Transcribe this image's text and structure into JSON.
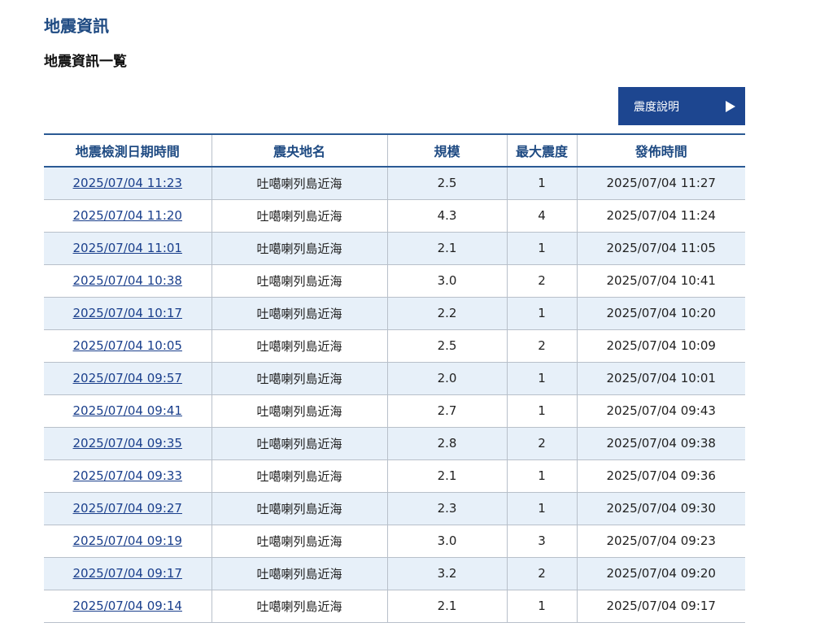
{
  "page": {
    "title": "地震資訊",
    "subtitle": "地震資訊一覧"
  },
  "intensity_button": {
    "label": "震度說明",
    "icon": "play-arrow-icon"
  },
  "colors": {
    "title": "#1e4a82",
    "button_bg": "#1d4690",
    "row_stripe": "#e7f0f9",
    "link": "#1a3f8c"
  },
  "table": {
    "columns": [
      "地震檢測日期時間",
      "震央地名",
      "規模",
      "最大震度",
      "發佈時間"
    ],
    "rows": [
      {
        "detected": "2025/07/04 11:23",
        "epicenter": "吐噶喇列島近海",
        "magnitude": "2.5",
        "max_intensity": "1",
        "published": "2025/07/04 11:27"
      },
      {
        "detected": "2025/07/04 11:20",
        "epicenter": "吐噶喇列島近海",
        "magnitude": "4.3",
        "max_intensity": "4",
        "published": "2025/07/04 11:24"
      },
      {
        "detected": "2025/07/04 11:01",
        "epicenter": "吐噶喇列島近海",
        "magnitude": "2.1",
        "max_intensity": "1",
        "published": "2025/07/04 11:05"
      },
      {
        "detected": "2025/07/04 10:38",
        "epicenter": "吐噶喇列島近海",
        "magnitude": "3.0",
        "max_intensity": "2",
        "published": "2025/07/04 10:41"
      },
      {
        "detected": "2025/07/04 10:17",
        "epicenter": "吐噶喇列島近海",
        "magnitude": "2.2",
        "max_intensity": "1",
        "published": "2025/07/04 10:20"
      },
      {
        "detected": "2025/07/04 10:05",
        "epicenter": "吐噶喇列島近海",
        "magnitude": "2.5",
        "max_intensity": "2",
        "published": "2025/07/04 10:09"
      },
      {
        "detected": "2025/07/04 09:57",
        "epicenter": "吐噶喇列島近海",
        "magnitude": "2.0",
        "max_intensity": "1",
        "published": "2025/07/04 10:01"
      },
      {
        "detected": "2025/07/04 09:41",
        "epicenter": "吐噶喇列島近海",
        "magnitude": "2.7",
        "max_intensity": "1",
        "published": "2025/07/04 09:43"
      },
      {
        "detected": "2025/07/04 09:35",
        "epicenter": "吐噶喇列島近海",
        "magnitude": "2.8",
        "max_intensity": "2",
        "published": "2025/07/04 09:38"
      },
      {
        "detected": "2025/07/04 09:33",
        "epicenter": "吐噶喇列島近海",
        "magnitude": "2.1",
        "max_intensity": "1",
        "published": "2025/07/04 09:36"
      },
      {
        "detected": "2025/07/04 09:27",
        "epicenter": "吐噶喇列島近海",
        "magnitude": "2.3",
        "max_intensity": "1",
        "published": "2025/07/04 09:30"
      },
      {
        "detected": "2025/07/04 09:19",
        "epicenter": "吐噶喇列島近海",
        "magnitude": "3.0",
        "max_intensity": "3",
        "published": "2025/07/04 09:23"
      },
      {
        "detected": "2025/07/04 09:17",
        "epicenter": "吐噶喇列島近海",
        "magnitude": "3.2",
        "max_intensity": "2",
        "published": "2025/07/04 09:20"
      },
      {
        "detected": "2025/07/04 09:14",
        "epicenter": "吐噶喇列島近海",
        "magnitude": "2.1",
        "max_intensity": "1",
        "published": "2025/07/04 09:17"
      }
    ]
  }
}
